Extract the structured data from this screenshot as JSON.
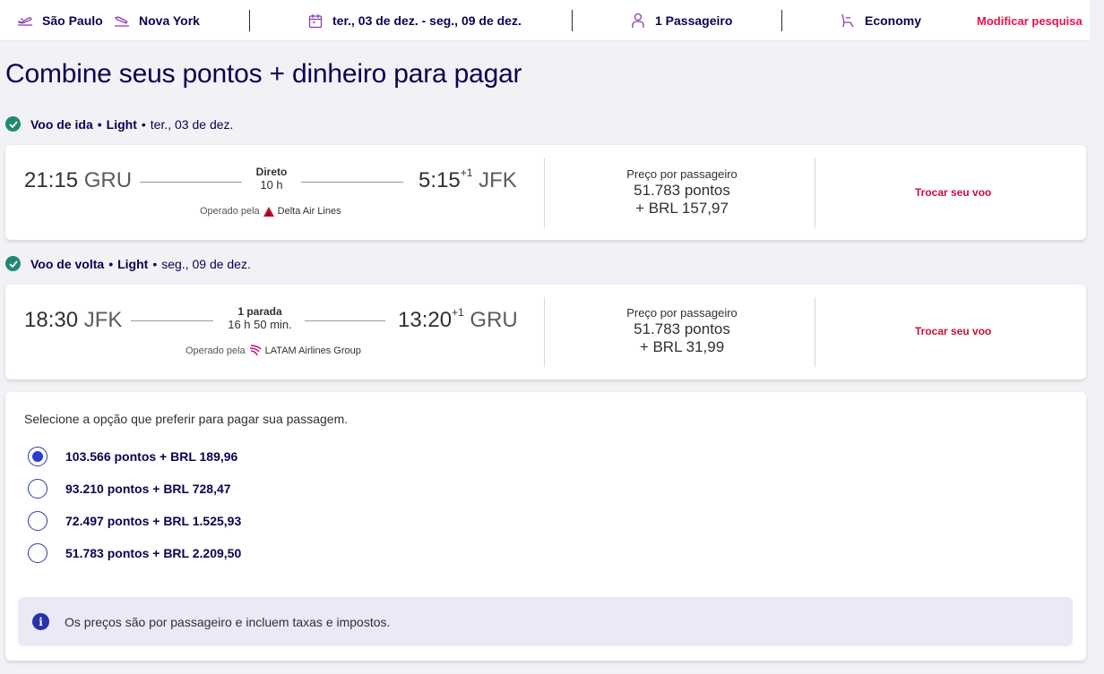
{
  "search": {
    "origin": "São Paulo",
    "destination": "Nova York",
    "dates": "ter., 03 de dez. - seg., 09 de dez.",
    "passengers": "1 Passageiro",
    "cabin": "Economy",
    "modify_label": "Modificar pesquisa"
  },
  "page": {
    "title": "Combine seus pontos + dinheiro para pagar"
  },
  "outbound": {
    "label": "Voo de ida",
    "fare": "Light",
    "date": "ter., 03 de dez.",
    "dep_time": "21:15",
    "dep_code": "GRU",
    "arr_time": "5:15",
    "arr_plus": "+1",
    "arr_code": "JFK",
    "stops": "Direto",
    "duration": "10 h",
    "operated_prefix": "Operado pela",
    "airline": "Delta Air Lines",
    "price_label": "Preço por passageiro",
    "price_points": "51.783 pontos",
    "price_brl": "+ BRL 157,97",
    "swap_label": "Trocar seu voo"
  },
  "inbound": {
    "label": "Voo de volta",
    "fare": "Light",
    "date": "seg., 09 de dez.",
    "dep_time": "18:30",
    "dep_code": "JFK",
    "arr_time": "13:20",
    "arr_plus": "+1",
    "arr_code": "GRU",
    "stops": "1 parada",
    "duration": "16 h 50 min.",
    "operated_prefix": "Operado pela",
    "airline": "LATAM Airlines Group",
    "price_label": "Preço por passageiro",
    "price_points": "51.783 pontos",
    "price_brl": "+ BRL 31,99",
    "swap_label": "Trocar seu voo"
  },
  "payment": {
    "prompt": "Selecione a opção que preferir para pagar sua passagem.",
    "options": [
      {
        "label": "103.566 pontos + BRL 189,96",
        "selected": true
      },
      {
        "label": "93.210 pontos + BRL 728,47",
        "selected": false
      },
      {
        "label": "72.497 pontos + BRL 1.525,93",
        "selected": false
      },
      {
        "label": "51.783 pontos + BRL 2.209,50",
        "selected": false
      }
    ],
    "info": "Os preços são por passageiro e incluem taxas e impostos."
  },
  "colors": {
    "brand_navy": "#1b0088",
    "accent_red": "#e8114b",
    "check_green": "#1f8a73",
    "radio_blue": "#2c3ad2"
  }
}
